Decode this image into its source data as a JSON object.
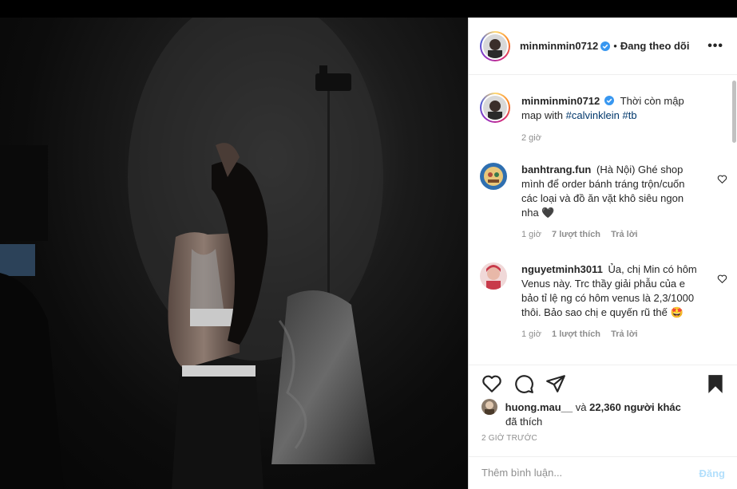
{
  "post": {
    "author": "minminmin0712",
    "separator": "•",
    "follow_status": "Đang theo dõi",
    "more_label": "•••",
    "caption": {
      "username": "minminmin0712",
      "text": "Thời còn mập map with",
      "hashtags": [
        "#calvinklein",
        "#tb"
      ],
      "time": "2 giờ"
    },
    "comments": [
      {
        "username": "banhtrang.fun",
        "text": "(Hà Nội) Ghé shop mình để order bánh tráng trộn/cuốn các loại và đồ ăn vặt khô siêu ngon nha 🖤",
        "time": "1 giờ",
        "likes": "7 lượt thích",
        "reply": "Trả lời"
      },
      {
        "username": "nguyetminh3011",
        "text": "Ủa, chị Min có hôm Venus này. Trc thầy giải phẫu của e bảo tỉ lệ ng có hôm venus là 2,3/1000 thôi. Bảo sao chị e quyến rũ thế 🤩",
        "time": "1 giờ",
        "likes": "1 lượt thích",
        "reply": "Trả lời"
      }
    ],
    "liked_by": {
      "user": "huong.mau__",
      "connector": "và",
      "others": "22,360 người khác",
      "suffix": "đã thích"
    },
    "timestamp": "2 GIỜ TRƯỚC",
    "add_comment": {
      "placeholder": "Thêm bình luận...",
      "post_label": "Đăng"
    }
  },
  "colors": {
    "verified": "#3897f0",
    "link": "#00376b",
    "secondary": "#8e8e8e",
    "post_disabled": "#b2dffc"
  },
  "icons": [
    "verified-badge-icon",
    "more-options-icon",
    "heart-icon",
    "comment-icon",
    "share-icon",
    "bookmark-icon"
  ]
}
